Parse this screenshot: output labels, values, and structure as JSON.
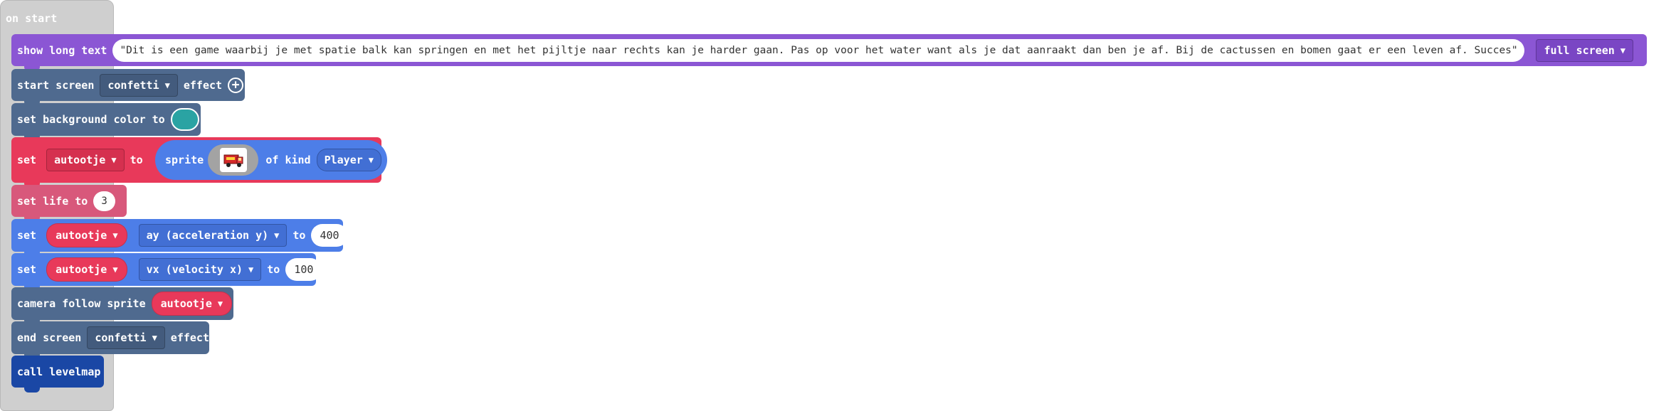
{
  "hat": {
    "label": "on start"
  },
  "show_long_text": {
    "label": "show long text",
    "text": "\"Dit is een game waarbij je met spatie balk kan springen en met het pijltje naar rechts kan je harder gaan. Pas op voor het water want als je dat aanraakt dan ben je af. Bij de cactussen en bomen gaat er een leven af. Succes\"",
    "mode": "full screen"
  },
  "start_screen": {
    "label": "start screen",
    "effect": "confetti",
    "suffix": "effect"
  },
  "background": {
    "label": "set background color to",
    "color": "#2aa3a3"
  },
  "set_sprite": {
    "set": "set",
    "var": "autootje",
    "to": "to",
    "sprite": "sprite",
    "of_kind": "of kind",
    "kind": "Player",
    "image_icon": "red-truck-icon"
  },
  "set_life": {
    "label": "set life to",
    "value": "3"
  },
  "set_ay": {
    "set": "set",
    "var": "autootje",
    "prop": "ay (acceleration y)",
    "to": "to",
    "value": "400"
  },
  "set_vx": {
    "set": "set",
    "var": "autootje",
    "prop": "vx (velocity x)",
    "to": "to",
    "value": "100"
  },
  "camera": {
    "label": "camera follow sprite",
    "var": "autootje"
  },
  "end_screen": {
    "label": "end screen",
    "effect": "confetti",
    "suffix": "effect"
  },
  "call": {
    "label": "call levelmap"
  },
  "colors": {
    "show_text": "#8b56d4",
    "scene": "#4f6a8f",
    "sprites": "#e8395a",
    "info": "#d8587b",
    "physics": "#4d7ee8",
    "functions": "#1a47a5",
    "hat": "#cfcfcf"
  }
}
